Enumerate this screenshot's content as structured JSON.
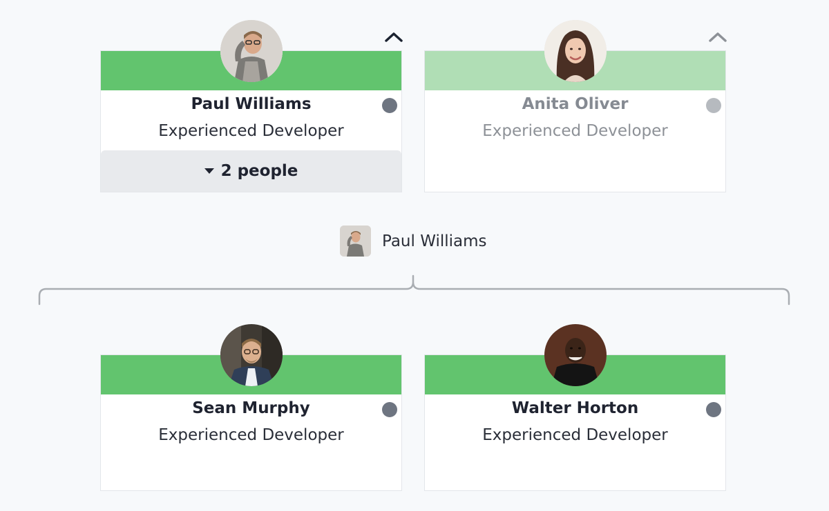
{
  "top_cards": [
    {
      "name": "Paul Williams",
      "role": "Experienced Developer",
      "expand_label": "2 people",
      "state": "active",
      "chevron": "chevron-up-icon"
    },
    {
      "name": "Anita Oliver",
      "role": "Experienced Developer",
      "state": "dimmed",
      "chevron": "chevron-up-icon"
    }
  ],
  "group": {
    "name": "Paul Williams"
  },
  "child_cards": [
    {
      "name": "Sean Murphy",
      "role": "Experienced Developer",
      "state": "active"
    },
    {
      "name": "Walter Horton",
      "role": "Experienced Developer",
      "state": "active"
    }
  ],
  "colors": {
    "active_band": "#62c46e",
    "muted_band": "#b0deb5",
    "status_dot": "#6e7581",
    "status_dot_dim": "#b6babf",
    "background": "#f7f9fb"
  }
}
